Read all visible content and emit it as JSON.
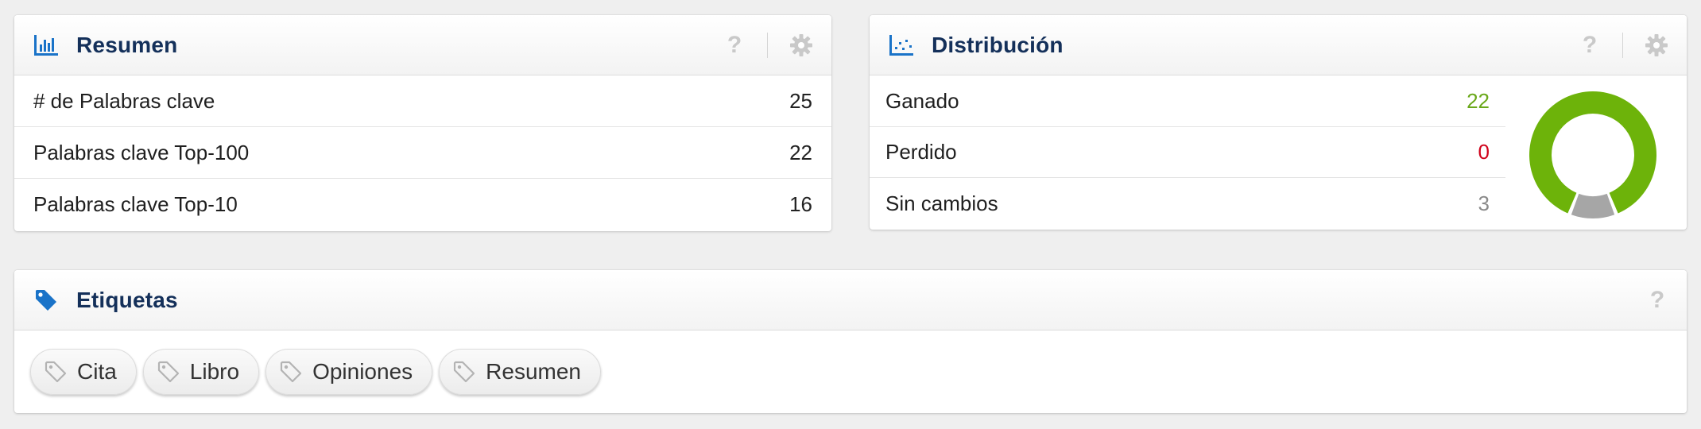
{
  "summary": {
    "title": "Resumen",
    "rows": [
      {
        "label": "# de Palabras clave",
        "value": "25"
      },
      {
        "label": "Palabras clave Top-100",
        "value": "22"
      },
      {
        "label": "Palabras clave Top-10",
        "value": "16"
      }
    ]
  },
  "distribution": {
    "title": "Distribución",
    "rows": [
      {
        "label": "Ganado",
        "value": "22",
        "color": "#6aa81a"
      },
      {
        "label": "Perdido",
        "value": "0",
        "color": "#d0021b"
      },
      {
        "label": "Sin cambios",
        "value": "3",
        "color": "#8a8a8a"
      }
    ],
    "donut": {
      "gained": 22,
      "lost": 0,
      "unchanged": 3,
      "gained_color": "#6db30a",
      "unchanged_color": "#a6a6a6"
    }
  },
  "tags": {
    "title": "Etiquetas",
    "items": [
      "Cita",
      "Libro",
      "Opiniones",
      "Resumen"
    ]
  },
  "icons": {
    "help": "?",
    "summary_icon": "bar-chart-icon",
    "distribution_icon": "scatter-chart-icon",
    "tags_icon": "tag-icon",
    "settings_icon": "gear-icon"
  },
  "colors": {
    "title": "#14305a",
    "accent": "#1a73c8"
  }
}
